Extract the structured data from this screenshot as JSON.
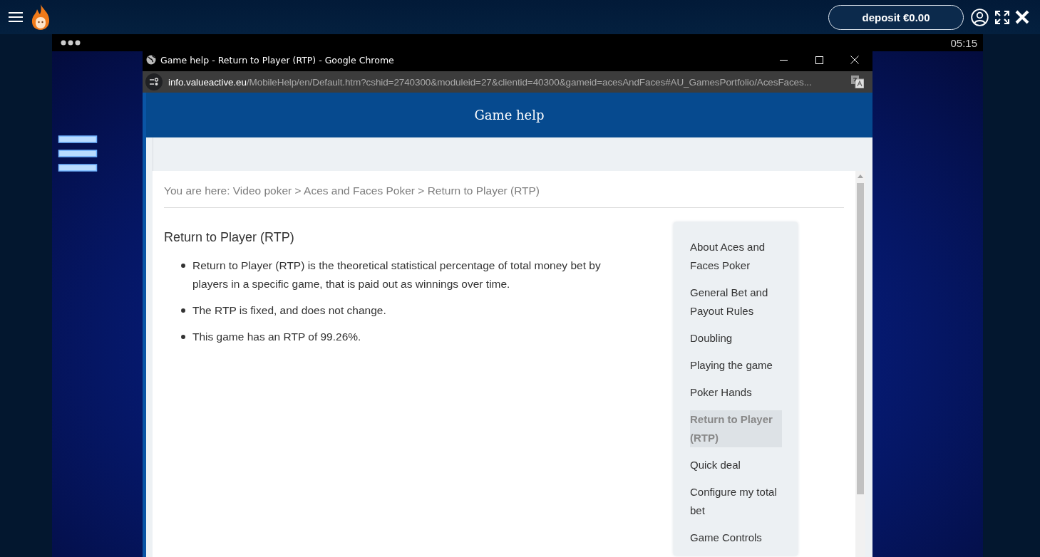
{
  "app_bar": {
    "deposit_button": "deposit €0.00"
  },
  "game": {
    "clock": "05:15"
  },
  "browser_window": {
    "title": "Game help - Return to Player (RTP) - Google Chrome",
    "url_host": "info.valueactive.eu",
    "url_path": "/MobileHelp/en/Default.htm?cshid=2740300&moduleid=27&clientid=40300&gameid=acesAndFaces#AU_GamesPortfolio/AcesFaces..."
  },
  "page": {
    "header": "Game help",
    "breadcrumb": "You are here: Video poker > Aces and Faces Poker > Return to Player (RTP)",
    "heading": "Return to Player (RTP)",
    "bullets": [
      "Return to Player (RTP) is the theoretical statistical percentage of total money bet by players in a specific game, that is paid out as winnings over time.",
      "The RTP is fixed, and does not change.",
      "This game has an RTP of 99.26%."
    ],
    "nav": [
      {
        "label": "About Aces and Faces Poker",
        "selected": false
      },
      {
        "label": "General Bet and Payout Rules",
        "selected": false
      },
      {
        "label": "Doubling",
        "selected": false
      },
      {
        "label": "Playing the game",
        "selected": false
      },
      {
        "label": "Poker Hands",
        "selected": false
      },
      {
        "label": "Return to Player (RTP)",
        "selected": true
      },
      {
        "label": "Quick deal",
        "selected": false
      },
      {
        "label": "Configure my total bet",
        "selected": false
      },
      {
        "label": "Game Controls",
        "selected": false
      }
    ]
  }
}
